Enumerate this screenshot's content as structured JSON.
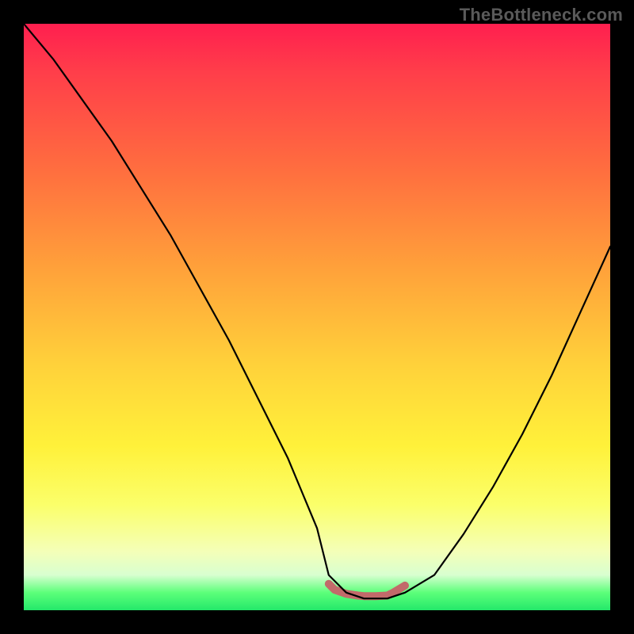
{
  "watermark": "TheBottleneck.com",
  "chart_data": {
    "type": "line",
    "title": "",
    "xlabel": "",
    "ylabel": "",
    "xlim": [
      0,
      100
    ],
    "ylim": [
      0,
      100
    ],
    "series": [
      {
        "name": "bottleneck-curve",
        "x": [
          0,
          5,
          10,
          15,
          20,
          25,
          30,
          35,
          40,
          45,
          50,
          52,
          55,
          58,
          62,
          65,
          70,
          75,
          80,
          85,
          90,
          95,
          100
        ],
        "y": [
          100,
          94,
          87,
          80,
          72,
          64,
          55,
          46,
          36,
          26,
          14,
          6,
          3,
          2,
          2,
          3,
          6,
          13,
          21,
          30,
          40,
          51,
          62
        ],
        "stroke": "#000000",
        "stroke_width": 2.2
      },
      {
        "name": "optimal-range-highlight",
        "x": [
          52,
          53,
          55,
          57,
          58,
          60,
          62,
          63,
          65
        ],
        "y": [
          4.5,
          3.5,
          2.8,
          2.5,
          2.4,
          2.4,
          2.5,
          3.0,
          4.2
        ],
        "stroke": "#c26a6a",
        "stroke_width": 10
      }
    ],
    "background_gradient": {
      "direction": "vertical",
      "stops": [
        {
          "pos": 0.0,
          "color": "#ff1f4f"
        },
        {
          "pos": 0.25,
          "color": "#ff6e3f"
        },
        {
          "pos": 0.58,
          "color": "#ffd13a"
        },
        {
          "pos": 0.82,
          "color": "#fbff6a"
        },
        {
          "pos": 0.94,
          "color": "#d8ffd0"
        },
        {
          "pos": 1.0,
          "color": "#24e86a"
        }
      ]
    }
  }
}
